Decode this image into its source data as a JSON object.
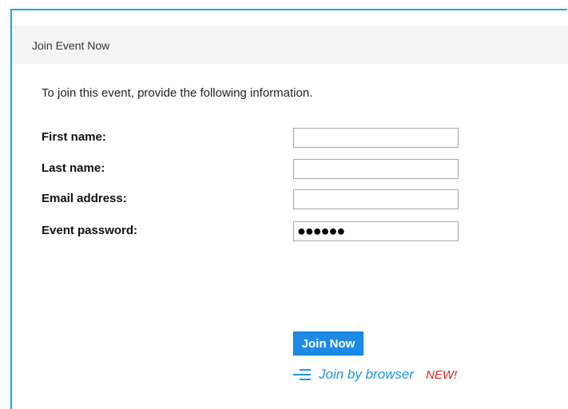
{
  "header": {
    "title": "Join Event Now"
  },
  "form": {
    "intro": "To join this event, provide the following information.",
    "first_name": {
      "label": "First name:",
      "value": ""
    },
    "last_name": {
      "label": "Last name:",
      "value": ""
    },
    "email": {
      "label": "Email address:",
      "value": ""
    },
    "password": {
      "label": "Event password:",
      "value": "●●●●●●"
    }
  },
  "actions": {
    "join_label": "Join Now",
    "browser_label": "Join by browser",
    "new_badge": "NEW!"
  },
  "colors": {
    "accent": "#1d8ae6",
    "link": "#1a95e0",
    "badge": "#e02020",
    "frame": "#1aa3e8"
  },
  "icons": {
    "browser": "menu-lines-icon"
  }
}
